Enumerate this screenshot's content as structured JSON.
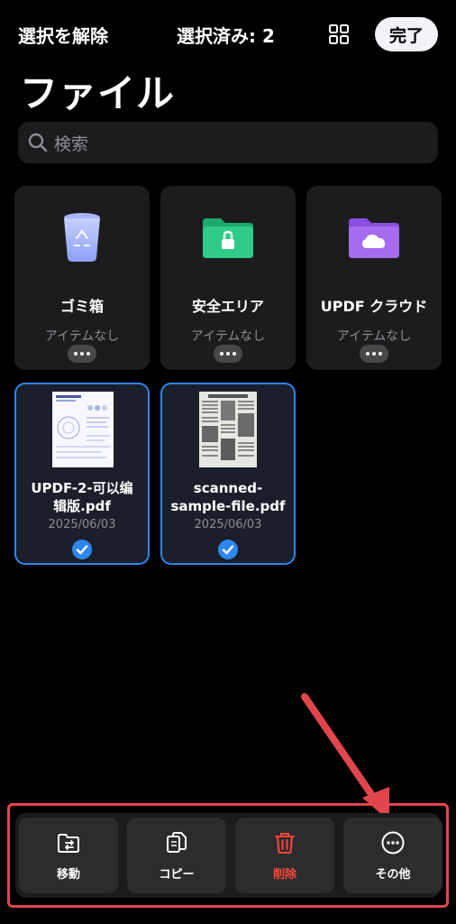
{
  "header": {
    "deselect_label": "選択を解除",
    "selection_label": "選択済み: 2",
    "view_toggle_icon": "grid-icon",
    "done_label": "完了"
  },
  "title": "ファイル",
  "search": {
    "placeholder": "検索",
    "icon": "search-icon"
  },
  "folders": [
    {
      "name": "ゴミ箱",
      "subtitle": "アイテムなし",
      "icon": "trash-bin-icon",
      "color": "#8ea0f5"
    },
    {
      "name": "安全エリア",
      "subtitle": "アイテムなし",
      "icon": "locked-folder-icon",
      "color": "#2ecc86"
    },
    {
      "name": "UPDF クラウド",
      "subtitle": "アイテムなし",
      "icon": "cloud-folder-icon",
      "color": "#a66cf0"
    }
  ],
  "files": [
    {
      "name_line1": "UPDF-2-可以编",
      "name_line2": "辑版.pdf",
      "date": "2025/06/03",
      "selected": true
    },
    {
      "name_line1": "scanned-",
      "name_line2": "sample-file.pdf",
      "date": "2025/06/03",
      "selected": true
    }
  ],
  "toolbar": {
    "move_label": "移動",
    "copy_label": "コピー",
    "delete_label": "削除",
    "more_label": "その他"
  },
  "colors": {
    "accent": "#2f86ef",
    "danger": "#ff453a",
    "annotation": "#e0464b",
    "background": "#000000",
    "card": "#1c1c1e"
  }
}
